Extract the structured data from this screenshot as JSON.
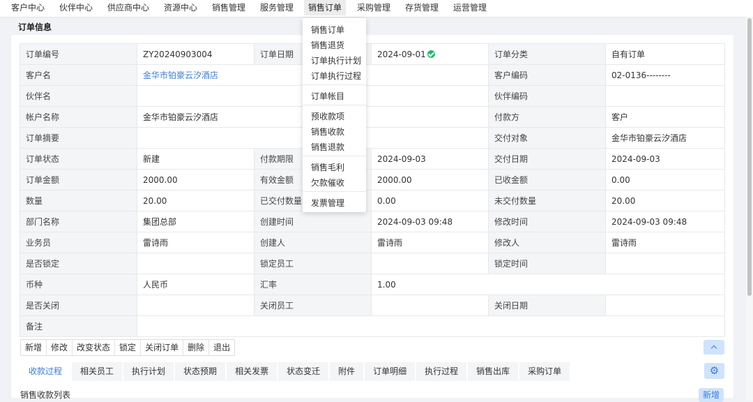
{
  "nav": {
    "items": [
      "客户中心",
      "伙伴中心",
      "供应商中心",
      "资源中心",
      "销售管理",
      "服务管理",
      "销售订单",
      "采购管理",
      "存货管理",
      "运营管理"
    ],
    "active": "销售订单"
  },
  "dropdown": {
    "items": [
      "销售订单",
      "销售退货",
      "订单执行计划",
      "订单执行过程",
      "订单帐目",
      "预收款项",
      "销售收款",
      "销售退款",
      "销售毛利",
      "欠款催收",
      "发票管理"
    ]
  },
  "section_title": "订单信息",
  "info": {
    "order_no_label": "订单编号",
    "order_no": "ZY20240903004",
    "order_date_label": "订单日期",
    "order_date": "2024-09-01",
    "order_type_label": "订单分类",
    "order_type": "自有订单",
    "customer_label": "客户名",
    "customer": "金华市铂豪云汐酒店",
    "customer_code_label": "客户编码",
    "customer_code": "02-0136--------",
    "partner_label": "伙伴名",
    "partner": "",
    "partner_code_label": "伙伴编码",
    "partner_code": "",
    "account_label": "帐户名称",
    "account": "金华市铂豪云汐酒店",
    "payer_label": "付款方",
    "payer": "客户",
    "summary_label": "订单摘要",
    "summary": "",
    "delivery_target_label": "交付对象",
    "delivery_target": "金华市铂豪云汐酒店",
    "status_label": "订单状态",
    "status": "新建",
    "pay_deadline_label": "付款期限",
    "pay_deadline": "2024-09-03",
    "delivery_date_label": "交付日期",
    "delivery_date": "2024-09-03",
    "amount_label": "订单金额",
    "amount": "2000.00",
    "effective_amount_label": "有效金额",
    "effective_amount": "2000.00",
    "received_label": "已收金额",
    "received": "0.00",
    "qty_label": "数量",
    "qty": "20.00",
    "delivered_qty_label": "已交付数量",
    "delivered_qty": "0.00",
    "undelivered_qty_label": "未交付数量",
    "undelivered_qty": "20.00",
    "dept_label": "部门名称",
    "dept": "集团总部",
    "created_time_label": "创建时间",
    "created_time": "2024-09-03 09:48",
    "modified_time_label": "修改时间",
    "modified_time": "2024-09-03 09:48",
    "salesman_label": "业务员",
    "salesman": "雷诗雨",
    "creator_label": "创建人",
    "creator": "雷诗雨",
    "modifier_label": "修改人",
    "modifier": "雷诗雨",
    "locked_label": "是否锁定",
    "locked": "",
    "lock_staff_label": "锁定员工",
    "lock_staff": "",
    "lock_time_label": "锁定时间",
    "lock_time": "",
    "currency_label": "币种",
    "currency": "人民币",
    "rate_label": "汇率",
    "rate": "1.00",
    "closed_label": "是否关闭",
    "closed": "",
    "close_staff_label": "关闭员工",
    "close_staff": "",
    "close_date_label": "关闭日期",
    "close_date": "",
    "remark_label": "备注",
    "remark": ""
  },
  "actions": [
    "新增",
    "修改",
    "改变状态",
    "锁定",
    "关闭订单",
    "删除",
    "退出"
  ],
  "tabs": [
    "收款过程",
    "相关员工",
    "执行计划",
    "状态预期",
    "相关发票",
    "状态变迁",
    "附件",
    "订单明细",
    "执行过程",
    "销售出库",
    "采购订单"
  ],
  "list_title": "销售收款列表",
  "add_label": "新增"
}
